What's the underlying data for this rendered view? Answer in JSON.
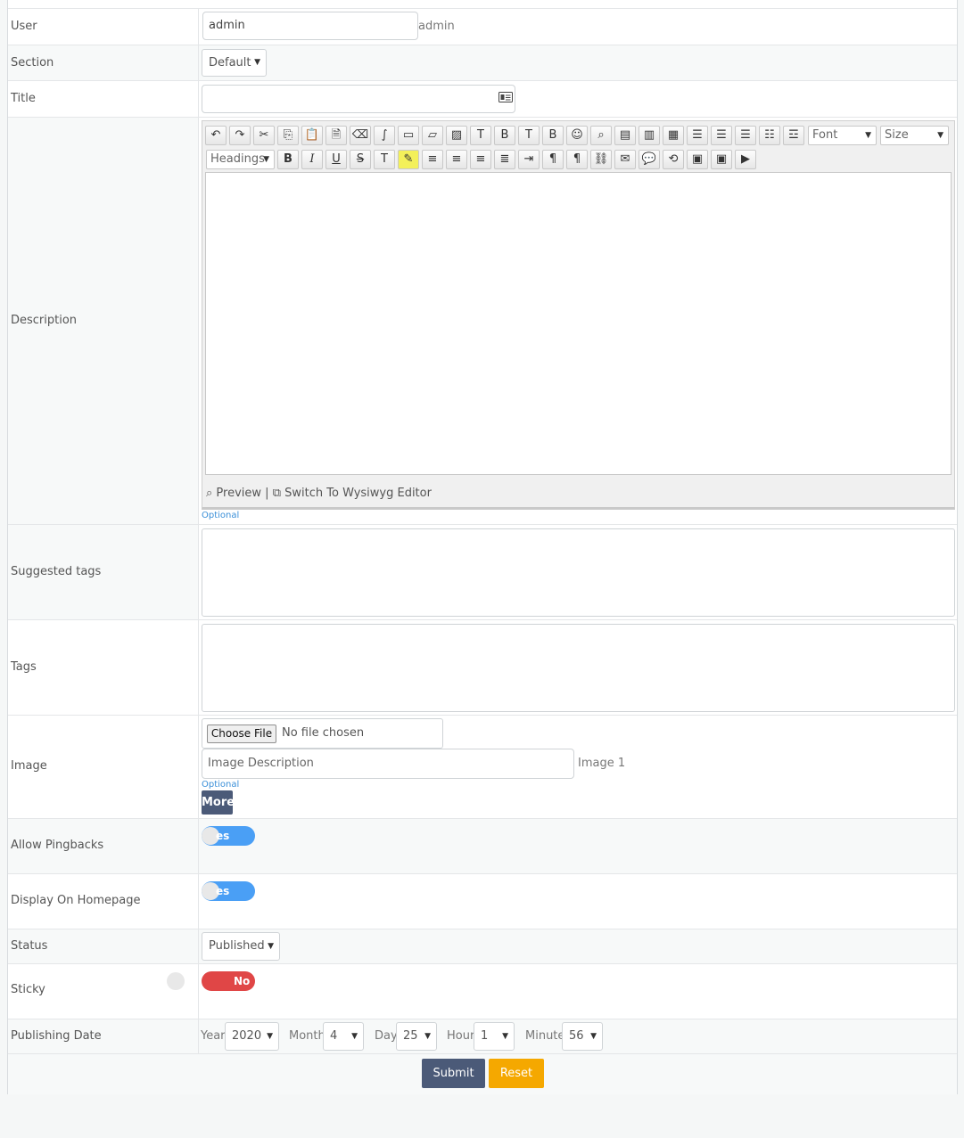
{
  "labels": {
    "user": "User",
    "section": "Section",
    "title": "Title",
    "description": "Description",
    "suggested_tags": "Suggested tags",
    "tags": "Tags",
    "image": "Image",
    "allow_pingbacks": "Allow Pingbacks",
    "display_on_homepage": "Display On Homepage",
    "status": "Status",
    "sticky": "Sticky",
    "publishing_date": "Publishing Date"
  },
  "user": {
    "value": "admin",
    "display": "admin"
  },
  "section": {
    "selected": "Default"
  },
  "title": {
    "value": ""
  },
  "editor": {
    "font_select": "Font",
    "size_select": "Size",
    "headings_select": "Headings",
    "preview_label": "Preview",
    "divider": "|",
    "switch_label": "Switch To Wysiwyg Editor",
    "optional": "Optional",
    "icon_colors": {
      "highlight": "#f3f05a"
    }
  },
  "image": {
    "choose_file": "Choose File",
    "no_file": "No file chosen",
    "description_placeholder": "Image Description",
    "image_label": "Image 1",
    "optional": "Optional",
    "more": "More"
  },
  "pingbacks": {
    "toggle_text": "es",
    "state": "on"
  },
  "homepage": {
    "toggle_text": "es",
    "state": "on"
  },
  "status": {
    "selected": "Published"
  },
  "sticky": {
    "toggle_text": "No",
    "state": "off"
  },
  "date": {
    "year_label": "Year",
    "year": "2020",
    "month_label": "Month",
    "month": "4",
    "day_label": "Day",
    "day": "25",
    "hour_label": "Hour",
    "hour": "1",
    "minute_label": "Minute",
    "minute": "56"
  },
  "actions": {
    "submit": "Submit",
    "reset": "Reset"
  },
  "colors": {
    "toggle_on": "#4a9ff5",
    "toggle_off": "#e04646",
    "submit": "#4b5a78",
    "reset": "#f5a800",
    "more": "#4b5a78",
    "link": "#3a8fd8"
  }
}
